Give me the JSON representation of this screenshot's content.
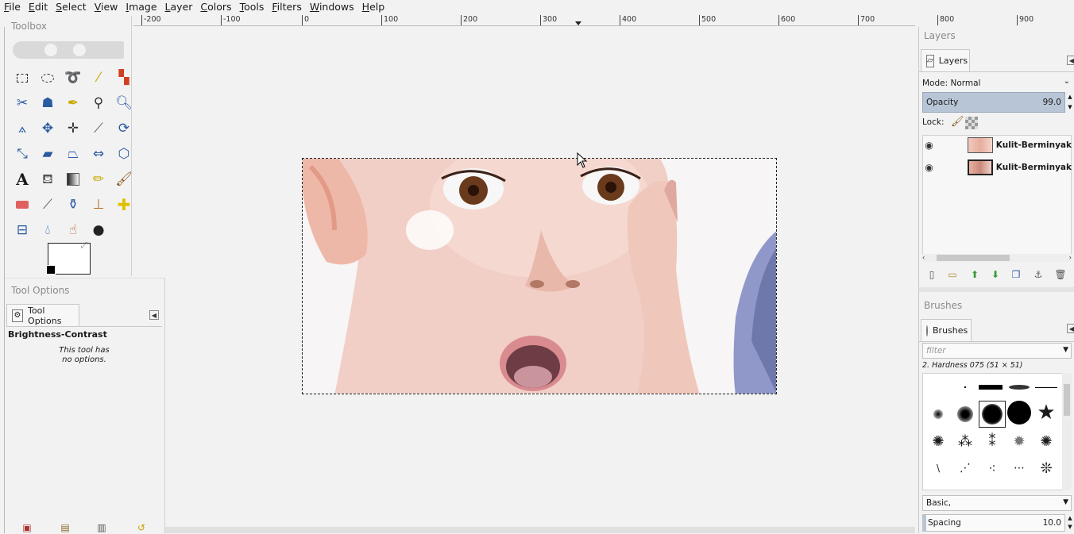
{
  "menubar": {
    "items": [
      {
        "label": "File",
        "mn": "F",
        "rest": "ile"
      },
      {
        "label": "Edit",
        "mn": "E",
        "rest": "dit"
      },
      {
        "label": "Select",
        "mn": "S",
        "rest": "elect"
      },
      {
        "label": "View",
        "mn": "V",
        "rest": "iew"
      },
      {
        "label": "Image",
        "mn": "I",
        "rest": "mage"
      },
      {
        "label": "Layer",
        "mn": "L",
        "rest": "ayer"
      },
      {
        "label": "Colors",
        "mn": "C",
        "rest": "olors"
      },
      {
        "label": "Tools",
        "mn": "T",
        "rest": "ools"
      },
      {
        "label": "Filters",
        "mn": "F",
        "rest": "ilters"
      },
      {
        "label": "Windows",
        "mn": "W",
        "rest": "indows"
      },
      {
        "label": "Help",
        "mn": "H",
        "rest": "elp"
      }
    ]
  },
  "ruler": {
    "labels": [
      "-200",
      "-100",
      "0",
      "100",
      "200",
      "300",
      "400",
      "500",
      "600",
      "700",
      "800",
      "900"
    ]
  },
  "toolbox": {
    "title": "Toolbox"
  },
  "tool_options": {
    "panel_title": "Tool Options",
    "tab_label": "Tool Options",
    "tool_name": "Brightness-Contrast",
    "message_line1": "This tool has",
    "message_line2": "no options."
  },
  "layers": {
    "panel_title": "Layers",
    "tab_label": "Layers",
    "mode_label": "Mode: Normal",
    "opacity_label": "Opacity",
    "opacity_value": "99.0",
    "lock_label": "Lock:",
    "items": [
      {
        "name": "Kulit-Berminyak"
      },
      {
        "name": "Kulit-Berminyak"
      }
    ]
  },
  "brushes": {
    "panel_title": "Brushes",
    "tab_label": "Brushes",
    "filter_placeholder": "filter",
    "selected_brush": "2. Hardness 075 (51 × 51)",
    "preset": "Basic,",
    "spacing_label": "Spacing",
    "spacing_value": "10.0"
  },
  "colors": {
    "accent": "#b8c5d6",
    "opacity_fill": "#b8c5d6",
    "selection_border": "#222222"
  }
}
